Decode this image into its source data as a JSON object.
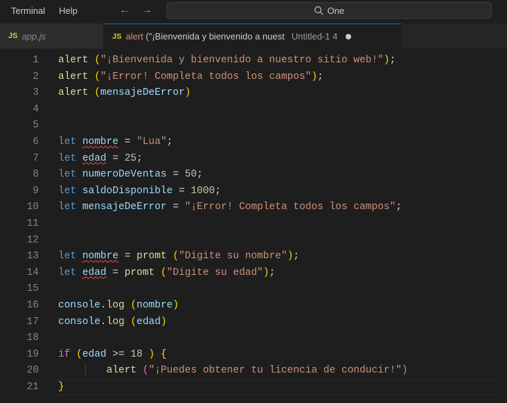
{
  "menubar": {
    "terminal": "Terminal",
    "help": "Help"
  },
  "search": {
    "value": "One"
  },
  "tabs": [
    {
      "badge": "JS",
      "label": "app.js"
    },
    {
      "badge": "JS",
      "title_alert": "alert",
      "title_rest": " (\"¡Bienvenida y bienvenido a nuest",
      "suffix": "Untitled-1 4"
    }
  ],
  "lines": {
    "count": 21
  },
  "code": {
    "alert": "alert",
    "str1": "\"¡Bienvenida y bienvenido a nuestro sitio web!\"",
    "str2": "\"¡Error! Completa todos los campos\"",
    "mensajeVar": "mensajeDeError",
    "let": "let",
    "nombre": "nombre",
    "strLua": "\"Lua\"",
    "edad": "edad",
    "n25": "25",
    "numeroDeVentas": "numeroDeVentas",
    "n50": "50",
    "saldoDisponible": "saldoDisponible",
    "n1000": "1000",
    "mensajeDeError": "mensajeDeError",
    "strErr": "\"¡Error! Completa todos los campos\"",
    "promt": "promt",
    "strDigiteNombre": "\"Digite su nombre\"",
    "strDigiteEdad": "\"Digite su edad\"",
    "console": "console",
    "log": "log",
    "if": "if",
    "ge": ">=",
    "n18": "18",
    "strLicencia": "\"¡Puedes obtener tu licencia de conducir!\""
  }
}
